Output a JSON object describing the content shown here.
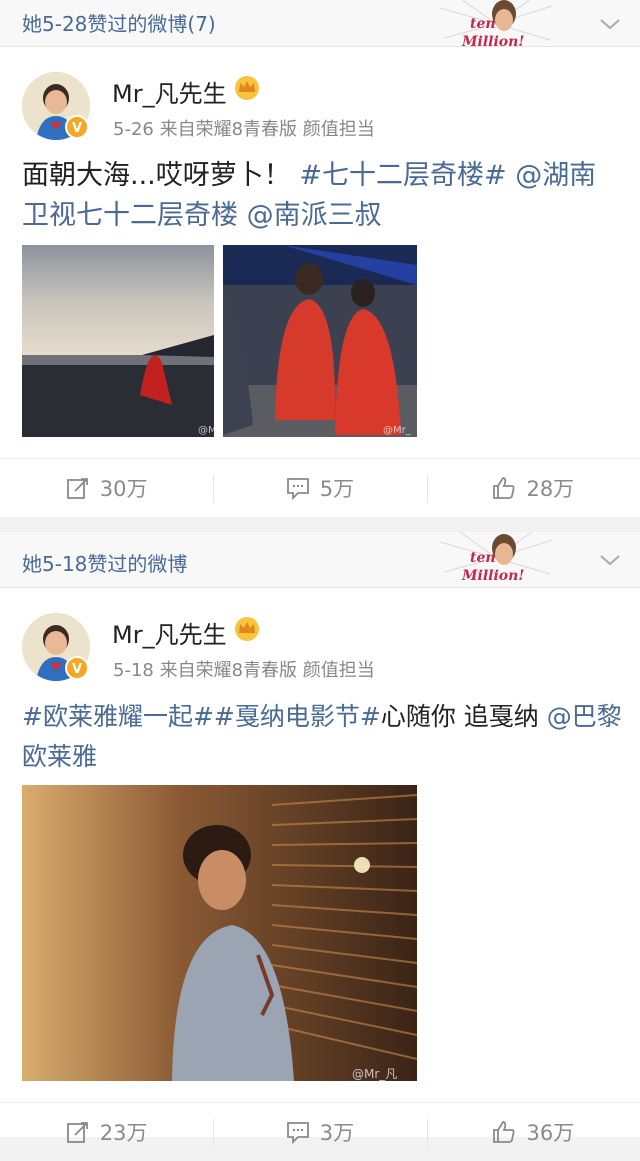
{
  "feed": [
    {
      "header": {
        "title": "她5-28赞过的微博(7)"
      },
      "post": {
        "username": "Mr_凡先生",
        "meta": "5-26 来自荣耀8青春版 颜值担当",
        "text_plain_1": "面朝大海...哎呀萝卜！",
        "tag_1": "#七十二层奇楼#",
        "text_plain_2": " ",
        "mention_1": "@湖南卫视七十二层奇楼",
        "mention_2": "@南派三叔",
        "image_watermark_1": "@Mr",
        "image_watermark_2": "@Mr_凡",
        "actions": {
          "repost": "30万",
          "comment": "5万",
          "like": "28万"
        }
      }
    },
    {
      "header": {
        "title": "她5-18赞过的微博"
      },
      "post": {
        "username": "Mr_凡先生",
        "meta": "5-18 来自荣耀8青春版 颜值担当",
        "tag_1": "#欧莱雅耀一起#",
        "tag_2": "#戛纳电影节#",
        "text_plain": "心随你 追戛纳",
        "mention_1": "@巴黎欧莱雅",
        "image_watermark": "@Mr_凡",
        "actions": {
          "repost": "23万",
          "comment": "3万",
          "like": "36万"
        }
      }
    }
  ],
  "badge": {
    "line1": "ten",
    "line2": "Million!"
  },
  "colors": {
    "link": "#4a6a96",
    "header_bg": "#f8f8f8",
    "meta": "#888888",
    "icon": "#8a8a8a"
  }
}
